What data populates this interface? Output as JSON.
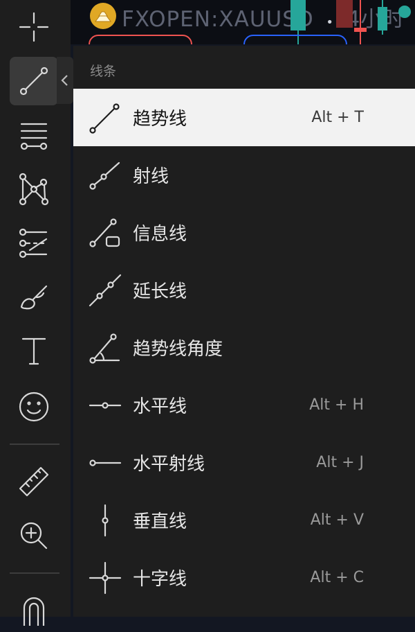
{
  "header": {
    "symbol": "FXOPEN:XAUUSD",
    "interval": "4小时"
  },
  "toolbar": {
    "tools": [
      {
        "name": "crosshair",
        "icon": "crosshair-icon"
      },
      {
        "name": "trend-line",
        "icon": "trend-line-icon",
        "active": true
      },
      {
        "name": "fib",
        "icon": "fib-levels-icon"
      },
      {
        "name": "patterns",
        "icon": "pattern-icon"
      },
      {
        "name": "prediction",
        "icon": "prediction-icon"
      },
      {
        "name": "brush",
        "icon": "brush-icon"
      },
      {
        "name": "text",
        "icon": "text-icon"
      },
      {
        "name": "emoji",
        "icon": "emoji-icon"
      },
      {
        "name": "ruler",
        "icon": "ruler-icon"
      },
      {
        "name": "zoom",
        "icon": "zoom-in-icon"
      },
      {
        "name": "magnet",
        "icon": "magnet-icon"
      }
    ]
  },
  "menu": {
    "section_title": "线条",
    "items": [
      {
        "label": "趋势线",
        "shortcut": "Alt + T",
        "icon": "trend-line-icon",
        "selected": true
      },
      {
        "label": "射线",
        "shortcut": "",
        "icon": "ray-icon"
      },
      {
        "label": "信息线",
        "shortcut": "",
        "icon": "info-line-icon"
      },
      {
        "label": "延长线",
        "shortcut": "",
        "icon": "extended-line-icon"
      },
      {
        "label": "趋势线角度",
        "shortcut": "",
        "icon": "trend-angle-icon"
      },
      {
        "label": "水平线",
        "shortcut": "Alt + H",
        "icon": "horizontal-line-icon"
      },
      {
        "label": "水平射线",
        "shortcut": "Alt + J",
        "icon": "horizontal-ray-icon"
      },
      {
        "label": "垂直线",
        "shortcut": "Alt + V",
        "icon": "vertical-line-icon"
      },
      {
        "label": "十字线",
        "shortcut": "Alt + C",
        "icon": "cross-line-icon"
      }
    ]
  },
  "colors": {
    "toolbar_bg": "#1e1e1e",
    "selected_bg": "#f2f2f2",
    "bull": "#26a69a",
    "bear": "#ef5350",
    "logo": "#e0a825"
  }
}
